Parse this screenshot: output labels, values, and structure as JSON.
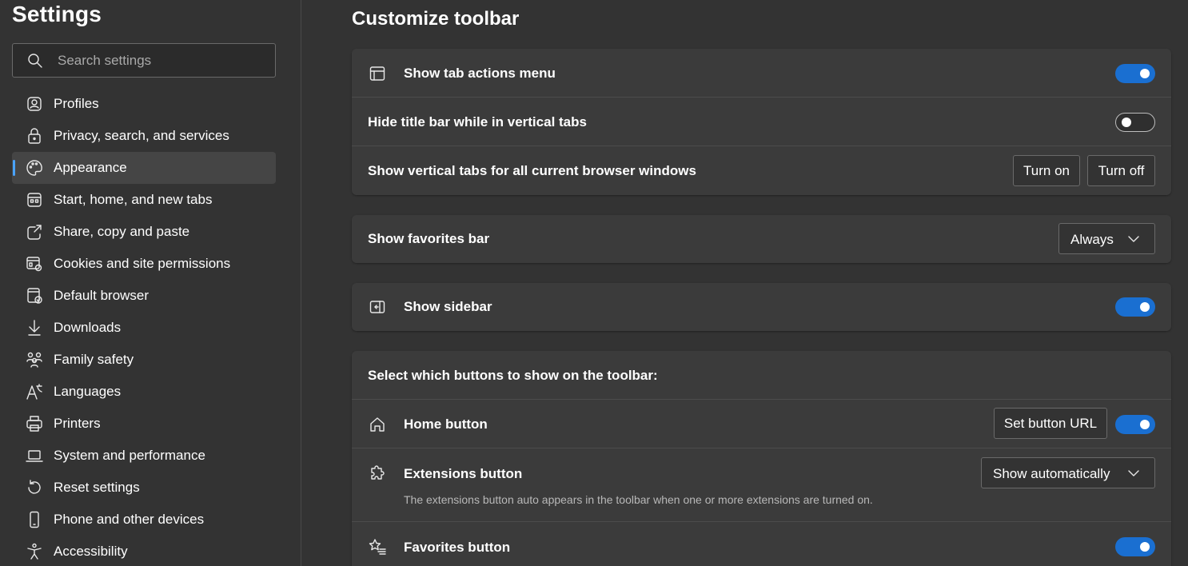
{
  "sidebar": {
    "title": "Settings",
    "search_placeholder": "Search settings",
    "items": [
      {
        "label": "Profiles",
        "icon": "profile-icon",
        "active": false
      },
      {
        "label": "Privacy, search, and services",
        "icon": "lock-icon",
        "active": false
      },
      {
        "label": "Appearance",
        "icon": "palette-icon",
        "active": true
      },
      {
        "label": "Start, home, and new tabs",
        "icon": "start-tabs-icon",
        "active": false
      },
      {
        "label": "Share, copy and paste",
        "icon": "share-icon",
        "active": false
      },
      {
        "label": "Cookies and site permissions",
        "icon": "cookies-icon",
        "active": false
      },
      {
        "label": "Default browser",
        "icon": "default-browser-icon",
        "active": false
      },
      {
        "label": "Downloads",
        "icon": "download-icon",
        "active": false
      },
      {
        "label": "Family safety",
        "icon": "family-icon",
        "active": false
      },
      {
        "label": "Languages",
        "icon": "languages-icon",
        "active": false
      },
      {
        "label": "Printers",
        "icon": "printer-icon",
        "active": false
      },
      {
        "label": "System and performance",
        "icon": "laptop-icon",
        "active": false
      },
      {
        "label": "Reset settings",
        "icon": "reset-icon",
        "active": false
      },
      {
        "label": "Phone and other devices",
        "icon": "phone-icon",
        "active": false
      },
      {
        "label": "Accessibility",
        "icon": "accessibility-icon",
        "active": false
      }
    ]
  },
  "main": {
    "title": "Customize toolbar",
    "tabs_card": {
      "show_tab_actions": {
        "label": "Show tab actions menu",
        "enabled": true
      },
      "hide_title_bar": {
        "label": "Hide title bar while in vertical tabs",
        "enabled": false
      },
      "vertical_tabs": {
        "label": "Show vertical tabs for all current browser windows",
        "turn_on": "Turn on",
        "turn_off": "Turn off"
      }
    },
    "favorites_bar": {
      "label": "Show favorites bar",
      "value": "Always"
    },
    "sidebar_card": {
      "label": "Show sidebar",
      "enabled": true
    },
    "toolbar_buttons": {
      "heading": "Select which buttons to show on the toolbar:",
      "home": {
        "label": "Home button",
        "set_url": "Set button URL",
        "enabled": true
      },
      "extensions": {
        "label": "Extensions button",
        "value": "Show automatically",
        "description": "The extensions button auto appears in the toolbar when one or more extensions are turned on."
      },
      "favorites": {
        "label": "Favorites button",
        "enabled": true
      }
    }
  },
  "colors": {
    "background": "#333333",
    "card": "#3b3b3b",
    "accent": "#1a6fd1",
    "active_indicator": "#4aa3ff"
  }
}
